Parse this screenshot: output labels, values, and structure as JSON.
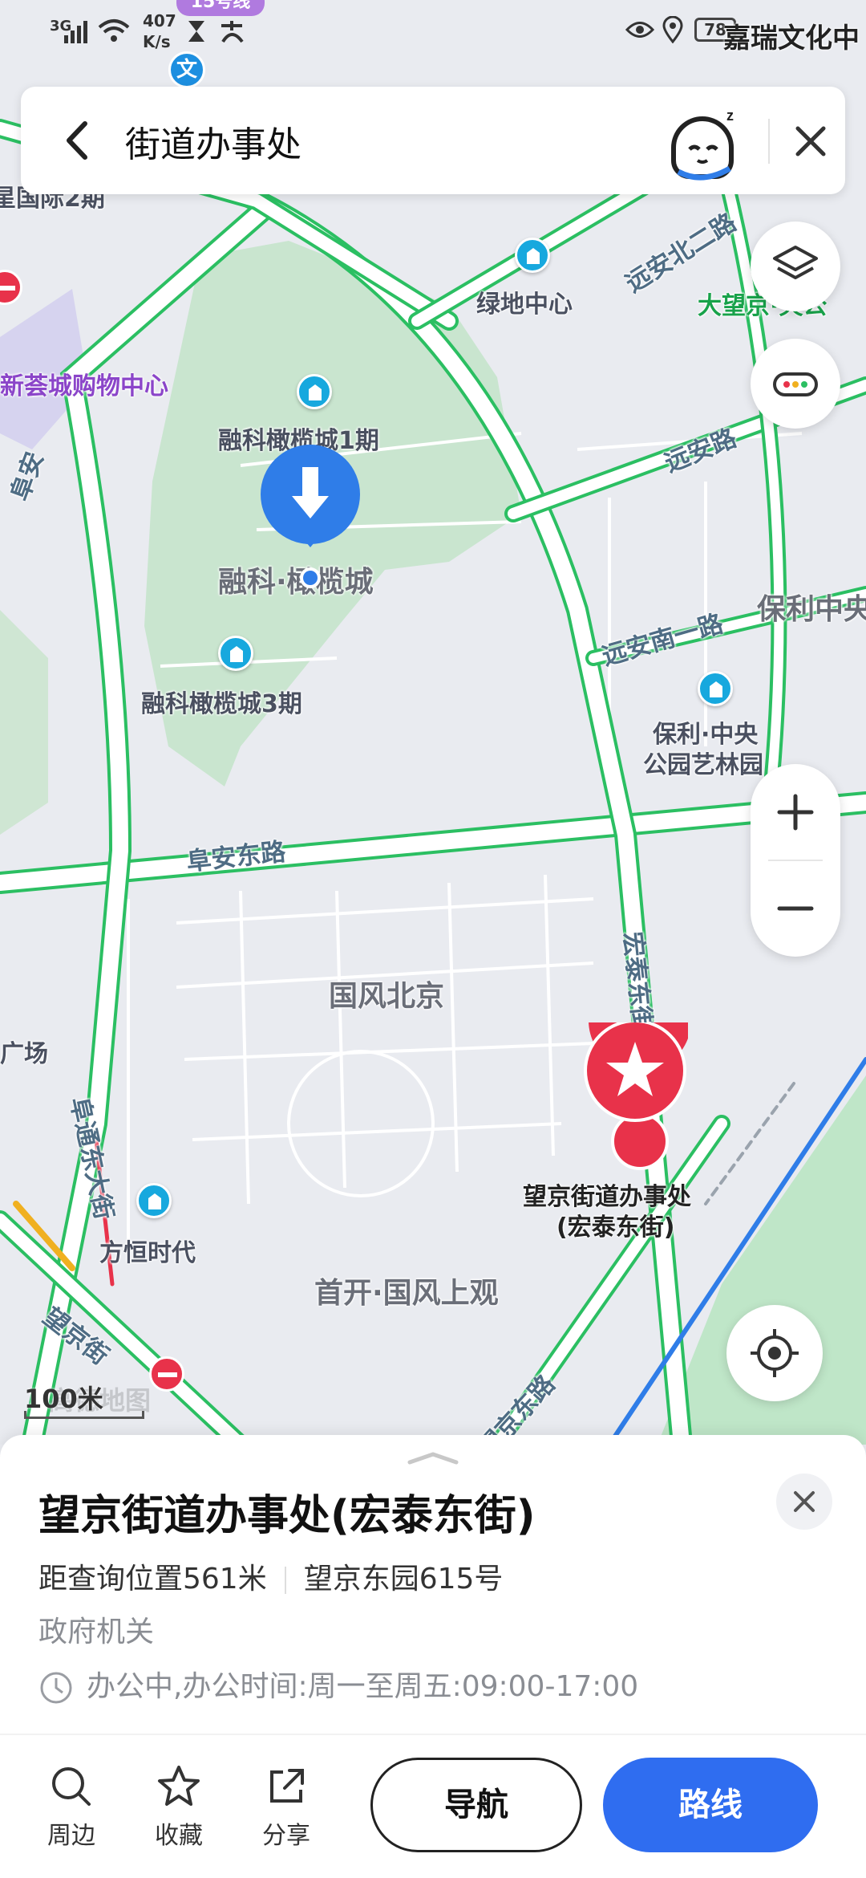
{
  "status_bar": {
    "signal_text": "3G",
    "speed_value": "407",
    "speed_unit": "K/s",
    "battery": "78",
    "top_right_label": "嘉瑞文化中",
    "top_badge": "15号线"
  },
  "search": {
    "query": "街道办事处",
    "back_icon": "chevron-left-icon",
    "assistant_icon": "assistant-robot-icon",
    "close_icon": "close-icon"
  },
  "map": {
    "labels": {
      "guoji": "星国际2期",
      "xinhuicheng": "新荟城购物中心",
      "fuan": "阜安",
      "lvdi": "绿地中心",
      "yuanan_north": "远安北二路",
      "dawang": "大望京·央公",
      "ronke1": "融科橄榄城1期",
      "ronke": "融科·橄榄城",
      "ronke3": "融科橄榄城3期",
      "yuanan": "远安路",
      "yuanan_south": "远安南一路",
      "poly": "保利中央",
      "poly_art_1": "保利·中央",
      "poly_art_2": "公园艺林园",
      "fuan_east": "阜安东路",
      "hongtai": "宏泰东街",
      "guofeng": "国风北京",
      "guangchang": "广场",
      "futong": "阜通东大街",
      "fangheng": "方恒时代",
      "target_1": "望京街道办事处",
      "target_2": "(宏泰东街)",
      "shoukai": "首开·国风上观",
      "wangjing_st": "望京街",
      "wangjing_east": "望京东路"
    },
    "scale": "100米",
    "watermark": "高德地图"
  },
  "place": {
    "name": "望京街道办事处(宏泰东街)",
    "distance": "距查询位置561米",
    "address": "望京东园615号",
    "category": "政府机关",
    "hours": "办公中,办公时间:周一至周五:09:00-17:00"
  },
  "actions": {
    "nearby": "周边",
    "favorite": "收藏",
    "share": "分享",
    "navigate": "导航",
    "route": "路线"
  },
  "colors": {
    "road_green": "#2bbf62",
    "accent_blue": "#2f6df0",
    "marker_red": "#e8324a",
    "poi_blue": "#17a8de"
  }
}
